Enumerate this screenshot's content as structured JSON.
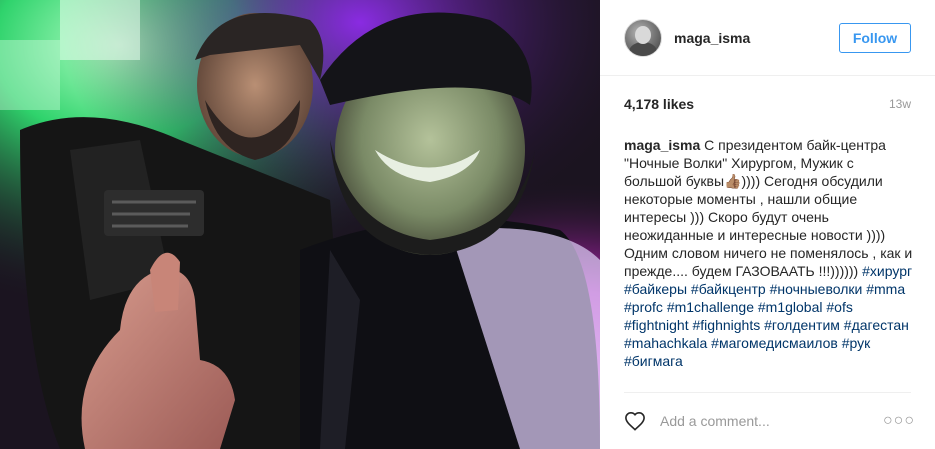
{
  "post": {
    "image_alt": "Selfie of two men at a night event",
    "accent_color": "#3897f0",
    "header": {
      "username": "maga_isma",
      "follow_label": "Follow"
    },
    "likes": "4,178 likes",
    "time_ago": "13w",
    "caption": {
      "username": "maga_isma",
      "text_lines": [
        "С президентом байк-центра",
        "\"Ночные Волки\" Хирургом, Мужик с",
        "большой буквы👍🏽)))) Сегодня обсудили",
        "некоторые моменты , нашли общие",
        "интересы ))) Скоро будут очень",
        "неожиданные и интересные новости ))))",
        "Одним словом ничего не поменялось ,",
        "как и прежде.... будем ГАЗОВААТЬ !!!))))))"
      ],
      "hashtags": [
        "#хирург",
        "#байкеры",
        "#байкцентр",
        "#ночныеволки",
        "#mma",
        "#profc",
        "#m1challenge",
        "#m1global",
        "#ofs",
        "#fightnight",
        "#fighnights",
        "#голдентим",
        "#дагестан",
        "#mahachkala",
        "#магомедисмаилов",
        "#рук",
        "#бигмага"
      ]
    },
    "comment": {
      "placeholder": "Add a comment...",
      "more_label": "○○○",
      "like_icon": "heart-outline-icon"
    }
  }
}
